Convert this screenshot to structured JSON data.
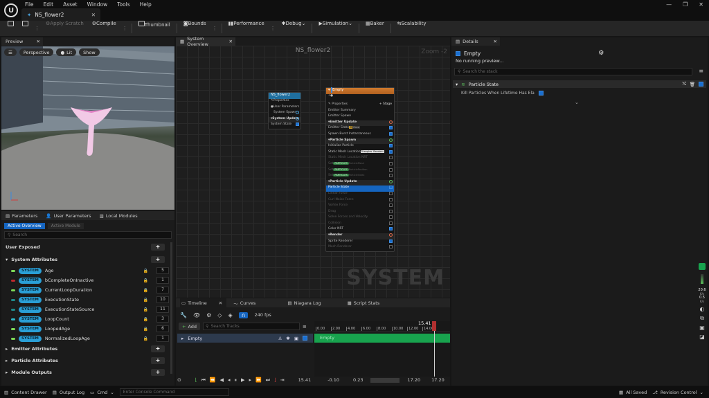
{
  "titlebar": {
    "menu": [
      "File",
      "Edit",
      "Asset",
      "Window",
      "Tools",
      "Help"
    ],
    "document_tab": "NS_flower2"
  },
  "toolbar": {
    "apply_scratch": "Apply Scratch",
    "compile": "Compile",
    "thumbnail": "Thumbnail",
    "bounds": "Bounds",
    "performance": "Performance",
    "debug": "Debug",
    "simulation": "Simulation",
    "baker": "Baker",
    "scalability": "Scalability"
  },
  "preview": {
    "tab": "Preview",
    "perspective": "Perspective",
    "lit": "Lit",
    "show": "Show"
  },
  "parameters": {
    "tabs": [
      "Parameters",
      "User Parameters",
      "Local Modules"
    ],
    "subtabs": [
      "Active Overview",
      "Active Module"
    ],
    "search_placeholder": "Search",
    "user_exposed": "User Exposed",
    "system_attributes": "System Attributes",
    "attr_badge": "SYSTEM",
    "attributes": [
      {
        "name": "Age",
        "value": "5",
        "color": "#7ed957"
      },
      {
        "name": "bCompleteOnInactive",
        "value": "1",
        "color": "#c0282d"
      },
      {
        "name": "CurrentLoopDuration",
        "value": "7",
        "color": "#7ed957"
      },
      {
        "name": "ExecutionState",
        "value": "10",
        "color": "#1f8a8a"
      },
      {
        "name": "ExecutionStateSource",
        "value": "11",
        "color": "#1f8a8a"
      },
      {
        "name": "LoopCount",
        "value": "3",
        "color": "#2fb7c8"
      },
      {
        "name": "LoopedAge",
        "value": "6",
        "color": "#7ed957"
      },
      {
        "name": "NormalizedLoopAge",
        "value": "1",
        "color": "#7ed957"
      }
    ],
    "sections": [
      "Emitter Attributes",
      "Particle Attributes",
      "Module Outputs"
    ]
  },
  "system_overview": {
    "tab": "System Overview",
    "title": "NS_flower2",
    "zoom": "Zoom -2",
    "watermark": "SYSTEM",
    "system_node": {
      "title": "NS_flower2",
      "rows": [
        "Properties",
        "User Parameters",
        "System Spawn",
        "System Update",
        "System State"
      ]
    },
    "emitter_node": {
      "title": "Empty",
      "properties": "Properties",
      "stage": "+ Stage",
      "rows": [
        {
          "label": "Emitter Summary",
          "kind": "plain"
        },
        {
          "label": "Emitter Spawn",
          "kind": "plain"
        },
        {
          "label": "Emitter Update",
          "kind": "hdr"
        },
        {
          "label": "Emitter State",
          "kind": "plain"
        },
        {
          "label": "Spawn Burst Instantaneous",
          "kind": "plain"
        },
        {
          "label": "Particle Spawn",
          "kind": "hdr"
        },
        {
          "label": "Initialize Particle",
          "kind": "plain"
        },
        {
          "label": "Static Mesh Location",
          "kind": "plain"
        },
        {
          "label": "Static Mesh Location NRT",
          "kind": "dim"
        },
        {
          "label": "Set",
          "kind": "dim"
        },
        {
          "label": "Set",
          "kind": "dim"
        },
        {
          "label": "Set",
          "kind": "dim"
        },
        {
          "label": "Particle Update",
          "kind": "hdr"
        },
        {
          "label": "Particle State",
          "kind": "sel"
        },
        {
          "label": "Linear Force",
          "kind": "dim"
        },
        {
          "label": "Curl Noise Force",
          "kind": "dim"
        },
        {
          "label": "Vortex Force",
          "kind": "dim"
        },
        {
          "label": "Drag",
          "kind": "dim"
        },
        {
          "label": "Solve Forces and Velocity",
          "kind": "dim"
        },
        {
          "label": "Collision",
          "kind": "dim"
        },
        {
          "label": "Color NRT",
          "kind": "plain"
        },
        {
          "label": "Render",
          "kind": "hdr"
        },
        {
          "label": "Sprite Renderer",
          "kind": "plain"
        },
        {
          "label": "Mesh Renderer",
          "kind": "dim"
        }
      ],
      "emitter_state_tag": "Once",
      "mesh_tags": [
        "Triangles",
        "Random"
      ],
      "pill": "PARTICLES",
      "pill_targets": [
        "ParticleMesh",
        "ParticlePosition",
        "ParticleIndex"
      ]
    }
  },
  "timeline": {
    "tabs": [
      "Timeline",
      "Curves",
      "Niagara Log",
      "Script Stats"
    ],
    "fps": "240 fps",
    "add": "Add",
    "search_placeholder": "Search Tracks",
    "track": "Empty",
    "playhead": "15.41",
    "ticks": [
      "0.00",
      "2.00",
      "4.00",
      "6.00",
      "8.00",
      "10.00",
      "12.00",
      "14.00"
    ],
    "bottom": {
      "time": "15.41",
      "start": "-0.10",
      "mid": "0.23",
      "end1": "17.20",
      "end2": "17.20"
    }
  },
  "details": {
    "tab": "Details",
    "name": "Empty",
    "status": "No running preview...",
    "search_placeholder": "Search the stack",
    "section": "Particle State",
    "property": "Kill Particles When Lifetime Has Ela"
  },
  "right_strip": {
    "fps": "20.6",
    "unit1": "K/s",
    "value2": "0.5",
    "unit2": "K/s"
  },
  "statusbar": {
    "content_drawer": "Content Drawer",
    "output_log": "Output Log",
    "cmd": "Cmd",
    "console_placeholder": "Enter Console Command",
    "all_saved": "All Saved",
    "revision": "Revision Control"
  }
}
